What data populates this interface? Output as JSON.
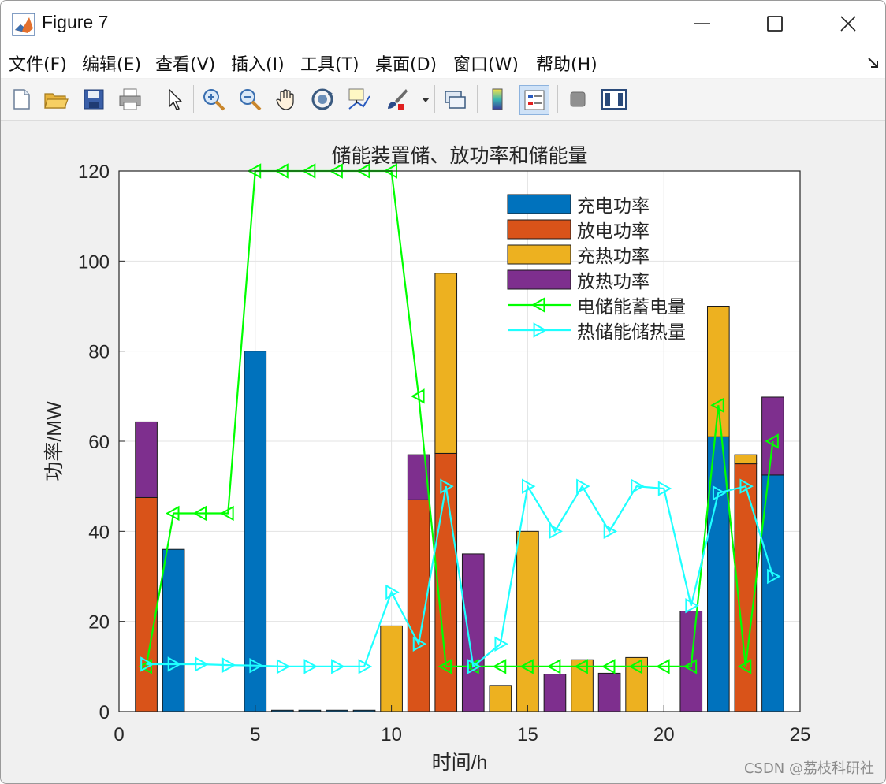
{
  "window": {
    "title": "Figure 7"
  },
  "menu": [
    "文件(F)",
    "编辑(E)",
    "查看(V)",
    "插入(I)",
    "工具(T)",
    "桌面(D)",
    "窗口(W)",
    "帮助(H)"
  ],
  "toolbar": [
    "new-figure-icon",
    "open-file-icon",
    "save-icon",
    "print-icon",
    "pointer-icon",
    "zoom-in-icon",
    "zoom-out-icon",
    "pan-hand-icon",
    "rotate-3d-icon",
    "data-cursor-icon",
    "brush-icon",
    "link-plot-icon",
    "colorbar-icon",
    "legend-icon",
    "hide-plot-tools-icon",
    "show-plot-tools-icon"
  ],
  "watermark": "CSDN @荔枝科研社",
  "chart_data": {
    "type": "bar",
    "stacked": true,
    "title": "储能装置储、放功率和储能量",
    "xlabel": "时间/h",
    "ylabel": "功率/MW",
    "xlim": [
      0,
      25
    ],
    "ylim": [
      0,
      120
    ],
    "xticks": [
      0,
      5,
      10,
      15,
      20,
      25
    ],
    "yticks": [
      0,
      20,
      40,
      60,
      80,
      100,
      120
    ],
    "grid": true,
    "legend_position": "top-right",
    "x": [
      1,
      2,
      3,
      4,
      5,
      6,
      7,
      8,
      9,
      10,
      11,
      12,
      13,
      14,
      15,
      16,
      17,
      18,
      19,
      20,
      21,
      22,
      23,
      24
    ],
    "series": [
      {
        "name": "充电功率",
        "type": "bar",
        "color": "#0072BD",
        "values": [
          0,
          36,
          0,
          0,
          80,
          0.3,
          0.3,
          0.3,
          0.3,
          0,
          0,
          0,
          0,
          0,
          0,
          0,
          0,
          0,
          0,
          0,
          0,
          61,
          0,
          52.5
        ]
      },
      {
        "name": "放电功率",
        "type": "bar",
        "color": "#D95319",
        "values": [
          47.5,
          0,
          0,
          0,
          0,
          0,
          0,
          0,
          0,
          0,
          47,
          57.3,
          0,
          0,
          0,
          0,
          0,
          0,
          0,
          0,
          0,
          0,
          55,
          0
        ]
      },
      {
        "name": "充热功率",
        "type": "bar",
        "color": "#EDB120",
        "values": [
          0,
          0,
          0,
          0,
          0,
          0,
          0,
          0,
          0,
          19,
          0,
          40,
          0,
          5.8,
          40,
          0,
          11.5,
          0,
          12,
          0,
          0,
          29,
          2,
          0
        ]
      },
      {
        "name": "放热功率",
        "type": "bar",
        "color": "#7E2F8E",
        "values": [
          16.8,
          0,
          0,
          0,
          0,
          0,
          0,
          0,
          0,
          0,
          10,
          0,
          35,
          0,
          0,
          8.3,
          0,
          8.5,
          0,
          0,
          22.3,
          0,
          0,
          17.3
        ]
      },
      {
        "name": "电储能蓄电量",
        "type": "line",
        "marker": "triangle-left",
        "color": "#00FF00",
        "values": [
          10,
          44,
          44,
          44,
          120,
          120,
          120,
          120,
          120,
          120,
          70,
          10,
          10,
          10,
          10,
          10,
          10,
          10,
          10,
          10,
          10,
          68,
          10,
          60
        ]
      },
      {
        "name": "热储能储热量",
        "type": "line",
        "marker": "triangle-right",
        "color": "#1EFFFF",
        "values": [
          10.5,
          10.5,
          10.5,
          10.3,
          10.2,
          10,
          10,
          10,
          10,
          26.5,
          15,
          50,
          10,
          15,
          50,
          40,
          50,
          40,
          50,
          49.5,
          23.5,
          48.5,
          50,
          30
        ]
      }
    ]
  }
}
